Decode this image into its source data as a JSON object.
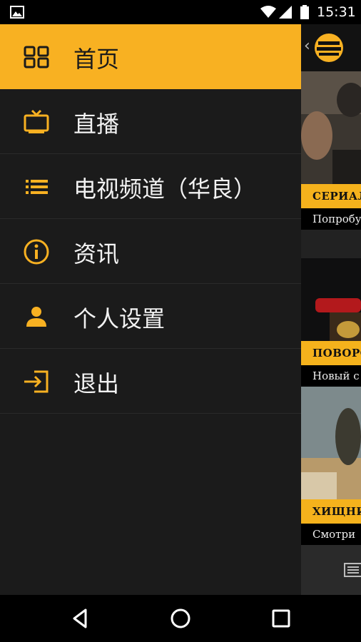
{
  "status_bar": {
    "time": "15:31",
    "icons": [
      "image-notification-icon",
      "wifi-icon",
      "signal-icon",
      "battery-icon"
    ]
  },
  "drawer": {
    "items": [
      {
        "label": "首页",
        "icon": "grid-icon",
        "active": true
      },
      {
        "label": "直播",
        "icon": "tv-icon",
        "active": false
      },
      {
        "label": "电视频道（华良）",
        "icon": "list-icon",
        "active": false
      },
      {
        "label": "资讯",
        "icon": "info-icon",
        "active": false
      },
      {
        "label": "个人设置",
        "icon": "person-icon",
        "active": false
      },
      {
        "label": "退出",
        "icon": "logout-icon",
        "active": false
      }
    ]
  },
  "background_app": {
    "cards": [
      {
        "tag": "СЕРИАЛ",
        "caption": "Попробуй"
      },
      {
        "tag": "ПОВОРО",
        "caption": "Новый с"
      },
      {
        "tag": "ХИЩНИ",
        "caption": "Смотри"
      }
    ]
  },
  "nav_bar": {
    "buttons": [
      "back-icon",
      "home-icon",
      "recents-icon"
    ]
  },
  "colors": {
    "accent": "#f8b122",
    "drawer_bg": "#1b1b1b",
    "divider": "#2a2a2a",
    "text": "#f2f2f2"
  }
}
